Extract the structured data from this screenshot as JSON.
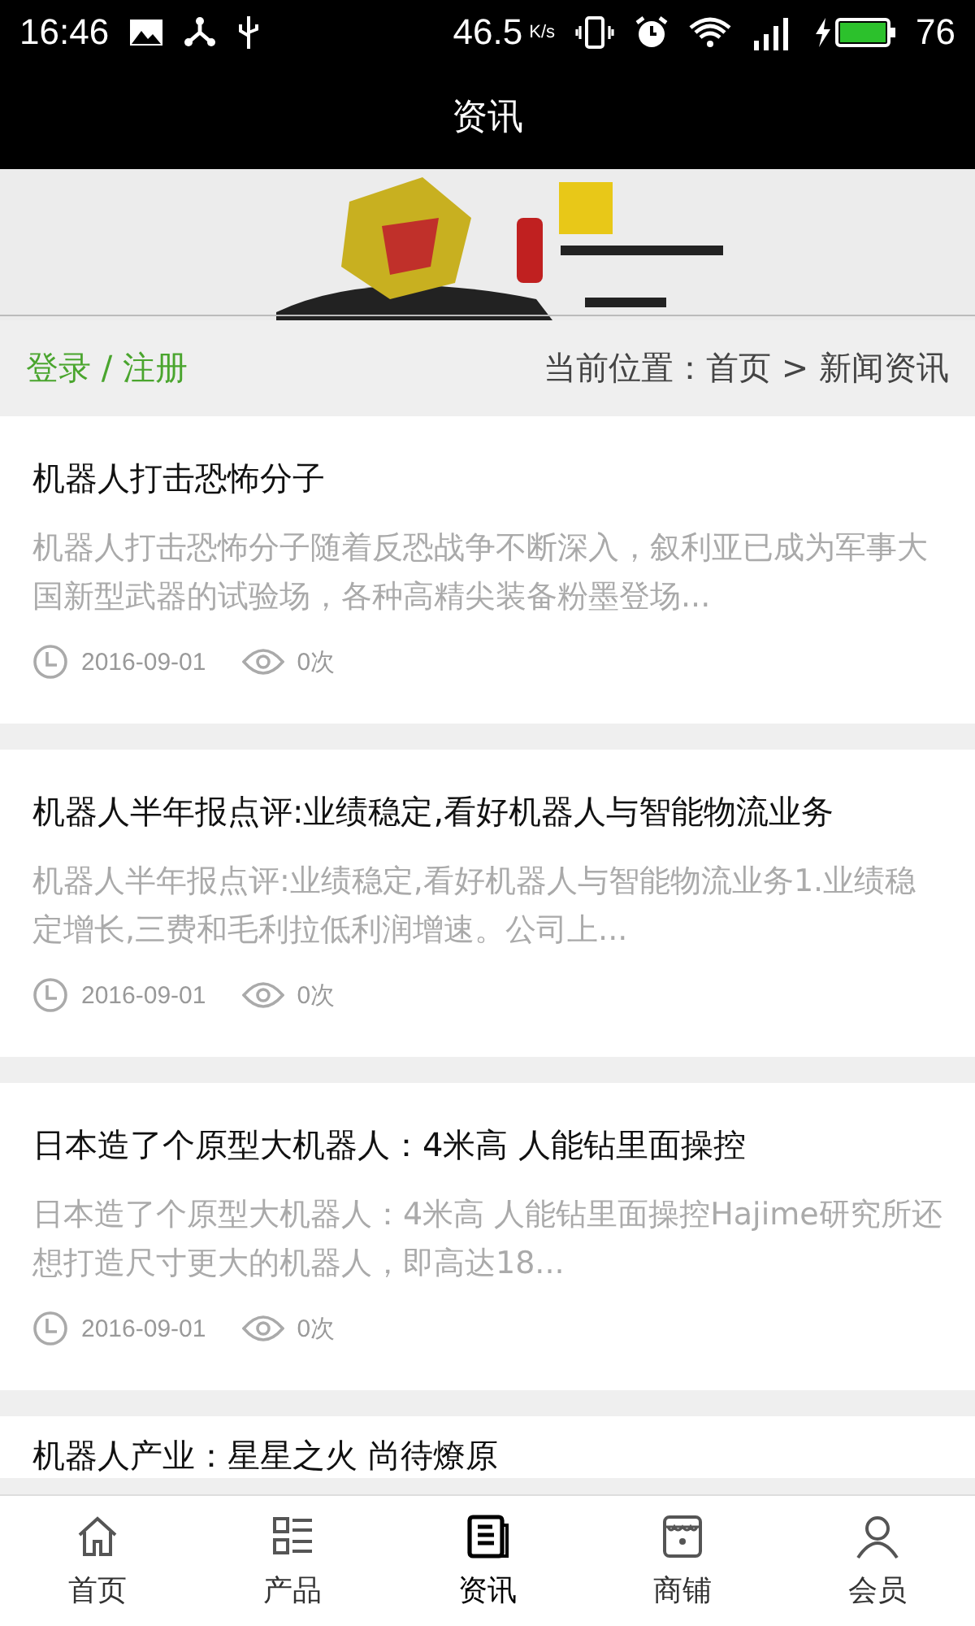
{
  "status_bar": {
    "time": "16:46",
    "speed": "46.5",
    "speed_unit": "K/s",
    "battery": "76"
  },
  "header": {
    "title": "资讯"
  },
  "breadcrumb": {
    "login": "登录 / 注册",
    "location": "当前位置：首页 > 新闻资讯"
  },
  "articles": [
    {
      "title": "机器人打击恐怖分子",
      "summary": "机器人打击恐怖分子随着反恐战争不断深入，叙利亚已成为军事大国新型武器的试验场，各种高精尖装备粉墨登场...",
      "date": "2016-09-01",
      "views": "0次"
    },
    {
      "title": "机器人半年报点评:业绩稳定,看好机器人与智能物流业务",
      "summary": "机器人半年报点评:业绩稳定,看好机器人与智能物流业务1.业绩稳定增长,三费和毛利拉低利润增速。公司上...",
      "date": "2016-09-01",
      "views": "0次"
    },
    {
      "title": "日本造了个原型大机器人：4米高 人能钻里面操控",
      "summary": "日本造了个原型大机器人：4米高 人能钻里面操控Hajime研究所还想打造尺寸更大的机器人，即高达18...",
      "date": "2016-09-01",
      "views": "0次"
    },
    {
      "title": "机器人产业：星星之火 尚待燎原"
    }
  ],
  "tabs": [
    {
      "label": "首页",
      "selected": false
    },
    {
      "label": "产品",
      "selected": false
    },
    {
      "label": "资讯",
      "selected": true
    },
    {
      "label": "商铺",
      "selected": false
    },
    {
      "label": "会员",
      "selected": false
    }
  ]
}
